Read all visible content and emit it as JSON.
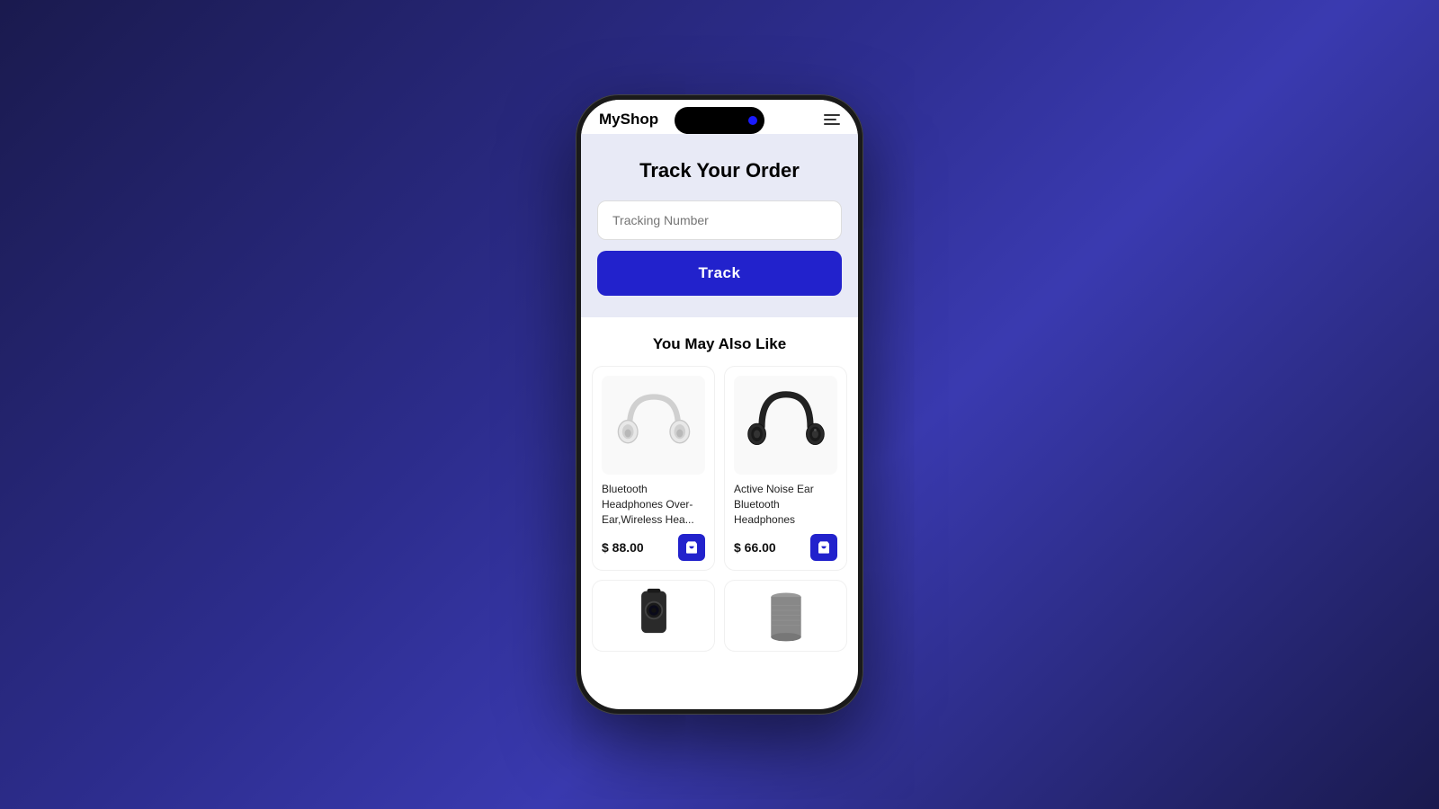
{
  "app": {
    "name": "MyShop"
  },
  "track_section": {
    "title": "Track Your Order",
    "input_placeholder": "Tracking Number",
    "button_label": "Track"
  },
  "products_section": {
    "title": "You May Also Like",
    "products": [
      {
        "id": "p1",
        "name": "Bluetooth Headphones Over-Ear,Wireless Hea...",
        "price": "$ 88.00",
        "color": "white"
      },
      {
        "id": "p2",
        "name": "Active Noise Ear Bluetooth Headphones",
        "price": "$ 66.00",
        "color": "black"
      }
    ]
  },
  "colors": {
    "brand_blue": "#2222cc",
    "track_bg": "#e8eaf6",
    "text_dark": "#000000",
    "text_gray": "#999999"
  }
}
